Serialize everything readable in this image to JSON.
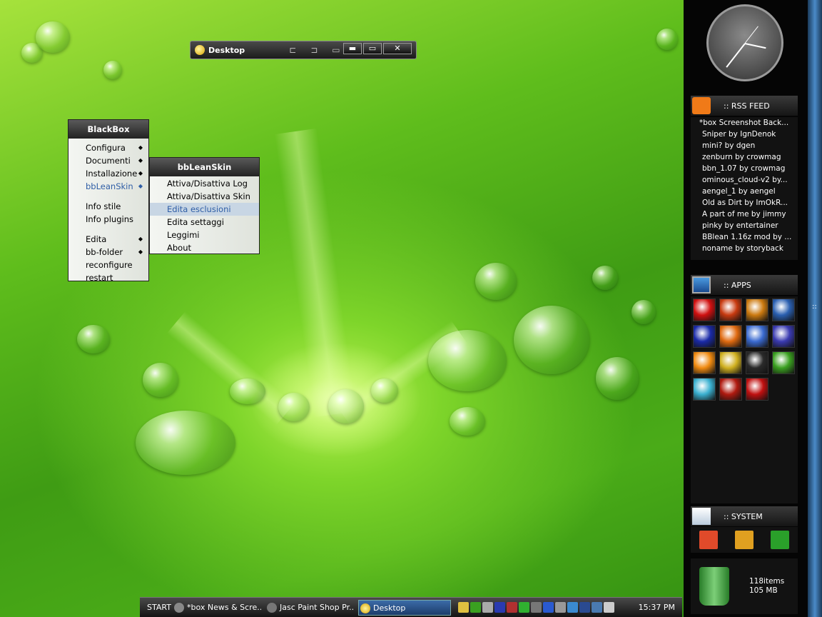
{
  "desktop_window": {
    "title": "Desktop",
    "buttons": [
      "▬",
      "▭",
      "✕"
    ]
  },
  "blackbox_menu": {
    "title": "BlackBox",
    "items": [
      {
        "label": "Configura",
        "submenu": true
      },
      {
        "label": "Documenti",
        "submenu": true
      },
      {
        "label": "Installazione",
        "submenu": true
      },
      {
        "label": "bbLeanSkin",
        "submenu": true,
        "selected": true
      },
      {
        "label": "Info stile",
        "submenu": false
      },
      {
        "label": "Info plugins",
        "submenu": false
      },
      {
        "label": "Edita",
        "submenu": true
      },
      {
        "label": "bb-folder",
        "submenu": true
      },
      {
        "label": "reconfigure",
        "submenu": false
      },
      {
        "label": "restart",
        "submenu": false
      }
    ]
  },
  "bbleanskin_menu": {
    "title": "bbLeanSkin",
    "items": [
      {
        "label": "Attiva/Disattiva Log"
      },
      {
        "label": "Attiva/Disattiva Skin"
      },
      {
        "label": "Edita esclusioni",
        "highlighted": true
      },
      {
        "label": "Edita settaggi"
      },
      {
        "label": "Leggimi"
      },
      {
        "label": "About"
      }
    ]
  },
  "rss": {
    "header": ":: RSS FEED",
    "items": [
      "*box Screenshot Back...",
      "Sniper by IgnDenok",
      "mini? by dgen",
      "zenburn by crowmag",
      "bbn_1.07 by crowmag",
      "ominous_cloud-v2 by...",
      "aengel_1 by aengel",
      "Old as Dirt by ImOkR...",
      "A part of me by jimmy",
      "pinky by entertainer",
      "BBlean 1.16z mod by ...",
      "noname by storyback"
    ]
  },
  "apps": {
    "header": ":: APPS",
    "icons": [
      {
        "name": "opera-icon",
        "color": "#d01010"
      },
      {
        "name": "winamp-icon",
        "color": "#c83a10"
      },
      {
        "name": "gallery-icon",
        "color": "#cc7a10"
      },
      {
        "name": "thunderbird-icon",
        "color": "#2a5fb0"
      },
      {
        "name": "messenger-m-icon",
        "color": "#1a2aa8"
      },
      {
        "name": "firefox-icon",
        "color": "#e06a10"
      },
      {
        "name": "paint-icon",
        "color": "#3a6ad0"
      },
      {
        "name": "film-icon",
        "color": "#3a3ab0"
      },
      {
        "name": "vlc-icon",
        "color": "#f08a10"
      },
      {
        "name": "7zip-icon",
        "color": "#d0b020"
      },
      {
        "name": "media-player-icon",
        "color": "#2a2a2a"
      },
      {
        "name": "utorrent-icon",
        "color": "#3aa020"
      },
      {
        "name": "msn-icon",
        "color": "#3ab0d0"
      },
      {
        "name": "filezilla-icon",
        "color": "#b01a10"
      },
      {
        "name": "acdsee-icon",
        "color": "#c01010"
      }
    ]
  },
  "system": {
    "header": ":: SYSTEM",
    "buttons": [
      {
        "name": "power-icon",
        "color": "#e04a2a"
      },
      {
        "name": "eject-icon",
        "color": "#e0a020"
      },
      {
        "name": "restart-icon",
        "color": "#2aa02a"
      }
    ]
  },
  "recycle_bin": {
    "items": "118items",
    "size": "105 MB"
  },
  "taskbar": {
    "start": "START",
    "tasks": [
      {
        "label": "*box News & Scre...",
        "active": false
      },
      {
        "label": "Jasc Paint Shop Pr...",
        "active": false
      },
      {
        "label": "Desktop",
        "active": true
      }
    ],
    "clock": "15:37 PM"
  },
  "edge_label": "::"
}
